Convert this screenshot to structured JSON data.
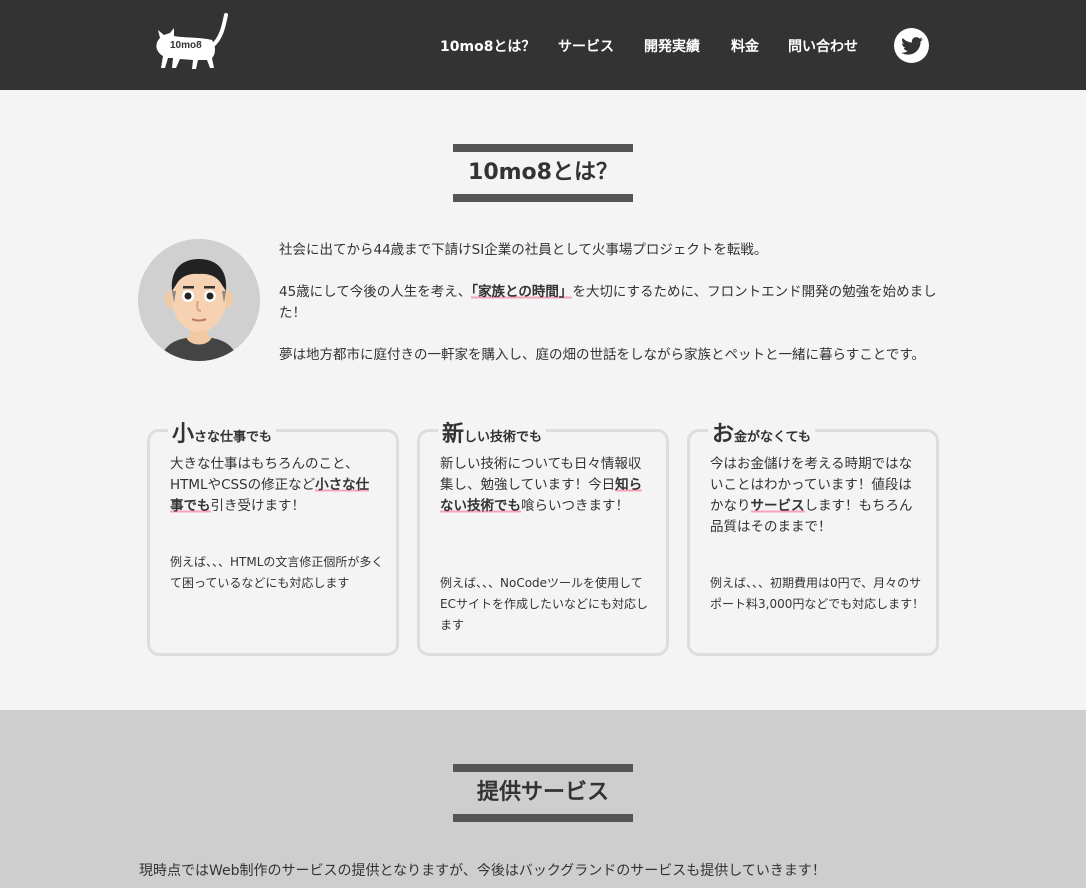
{
  "header": {
    "logo_text": "10mo8",
    "nav": [
      "10mo8とは？",
      "サービス",
      "開発実績",
      "料金",
      "問い合わせ"
    ],
    "twitter_icon": "twitter-icon"
  },
  "about": {
    "title": "10mo8とは？",
    "p1": "社会に出てから44歳まで下請けSI企業の社員として火事場プロジェクトを転戦。",
    "p2_pre": "45歳にして今後の人生を考え、",
    "p2_hl": "「家族との時間」",
    "p2_post": "を大切にするために、フロントエンド開発の勉強を始めました！",
    "p3": "夢は地方都市に庭付きの一軒家を購入し、庭の畑の世話をしながら家族とペットと一緒に暮らすことです。"
  },
  "cards": [
    {
      "head_big": "小",
      "head_small": "さな仕事でも",
      "main_pre": "大きな仕事はもちろんのこと、HTMLやCSSの修正など",
      "main_hl": "小さな仕事でも",
      "main_post": "引き受けます！",
      "sub": "例えば、、、HTMLの文言修正個所が多くて困っているなどにも対応します"
    },
    {
      "head_big": "新",
      "head_small": "しい技術でも",
      "main_pre": "新しい技術についても日々情報収集し、勉強しています！今日",
      "main_hl": "知らない技術でも",
      "main_post": "喰らいつきます！",
      "sub": "例えば、、、NoCodeツールを使用してECサイトを作成したいなどにも対応します"
    },
    {
      "head_big": "お",
      "head_small": "金がなくても",
      "main_pre": "今はお金儲けを考える時期ではないことはわかっています！値段はかなり",
      "main_hl": "サービス",
      "main_post": "します！もちろん品質はそのままで！",
      "sub": "例えば、、、初期費用は0円で、月々のサポート料3,000円などでも対応します！"
    }
  ],
  "service": {
    "title": "提供サービス",
    "text": "現時点ではWeb制作のサービスの提供となりますが、今後はバックグランドのサービスも提供していきます！"
  },
  "colors": {
    "header_bg": "#333333",
    "highlight": "#f7a3b8",
    "body_bg": "#f4f4f4",
    "service_bg": "#cecece"
  }
}
